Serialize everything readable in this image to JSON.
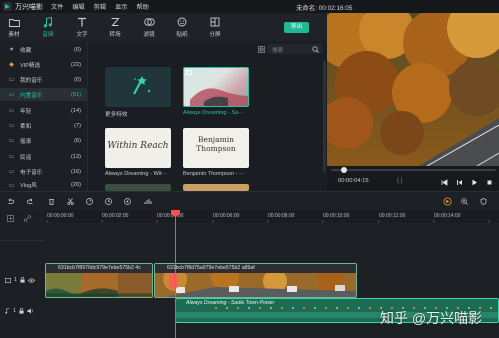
{
  "app": {
    "name": "万兴喵影",
    "menu": [
      "文件",
      "编辑",
      "剪辑",
      "显示",
      "帮助"
    ],
    "project_title": "未命名: 00:02:16:05"
  },
  "toolbar": {
    "tabs": [
      {
        "label": "素材",
        "icon": "folder-icon"
      },
      {
        "label": "音频",
        "icon": "music-note-icon"
      },
      {
        "label": "文字",
        "icon": "text-icon"
      },
      {
        "label": "转场",
        "icon": "transition-icon"
      },
      {
        "label": "滤镜",
        "icon": "filter-icon"
      },
      {
        "label": "贴纸",
        "icon": "sticker-icon"
      },
      {
        "label": "分屏",
        "icon": "split-screen-icon"
      }
    ],
    "active_tab": "音频",
    "export_label": "导出"
  },
  "sidebar": {
    "items": [
      {
        "label": "收藏",
        "count": "(0)",
        "icon": "heart-icon"
      },
      {
        "label": "VIP精选",
        "count": "(22)",
        "icon": "vip-icon"
      },
      {
        "label": "我的音乐",
        "count": "(0)",
        "icon": "folder-icon"
      },
      {
        "label": "内置音乐",
        "count": "(61)",
        "icon": "folder-icon",
        "active": true
      },
      {
        "label": "年轻",
        "count": "(14)",
        "icon": "folder-icon"
      },
      {
        "label": "柔和",
        "count": "(7)",
        "icon": "folder-icon"
      },
      {
        "label": "摇滚",
        "count": "(6)",
        "icon": "folder-icon"
      },
      {
        "label": "民谣",
        "count": "(13)",
        "icon": "folder-icon"
      },
      {
        "label": "电子音乐",
        "count": "(16)",
        "icon": "folder-icon"
      },
      {
        "label": "Vlog风",
        "count": "(20)",
        "icon": "folder-icon"
      }
    ]
  },
  "media": {
    "search_placeholder": "搜索",
    "items": [
      {
        "label": "更多特效"
      },
      {
        "label": "Always Dreaming - Sa···",
        "active": true,
        "cover": "Always Dreaming"
      },
      {
        "label": "Always Dreaming - Wit···",
        "cover": "Within Reach"
      },
      {
        "label": "Benjamin Thompson - ···",
        "cover": "Benjamin Thompson"
      }
    ]
  },
  "preview": {
    "timecode": "00:00:04:15",
    "brackets": "{        }"
  },
  "timeline": {
    "ruler": [
      "00:00:00:00",
      "00:00:02:00",
      "00:00:04:00",
      "00:00:06:00",
      "00:00:08:00",
      "00:00:10:00",
      "00:00:12:00",
      "00:00:14:00"
    ],
    "video_clips": [
      {
        "label": "631bcb7f8970dc979e7ebe575b2 4c"
      },
      {
        "label": "631bcb7f8d75a979e7ebe575b2 a89af"
      }
    ],
    "audio_clip": "Always Dreaming - Sadie Town·Power",
    "track_labels": {
      "video": "1",
      "audio": "1"
    }
  },
  "watermark": "知乎 @万兴喵影",
  "colors": {
    "accent": "#25c2a0",
    "playhead": "#ff4d4d",
    "audio_clip": "#1e6b53"
  }
}
